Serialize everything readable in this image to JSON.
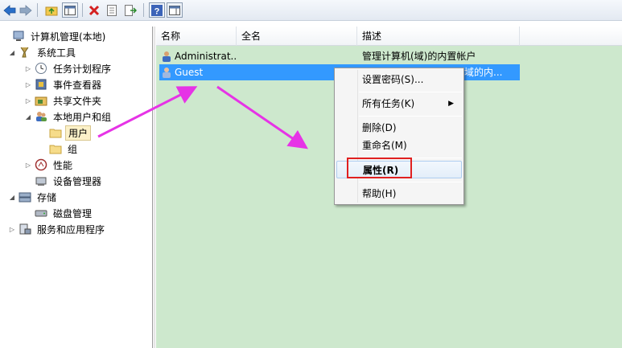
{
  "tree": {
    "items": [
      {
        "label": "计算机管理(本地)",
        "expander": "",
        "icon": "computer-management-icon"
      },
      {
        "label": "系统工具",
        "expander": "◢",
        "icon": "system-tools-icon"
      },
      {
        "label": "任务计划程序",
        "expander": "▷",
        "icon": "task-scheduler-icon"
      },
      {
        "label": "事件查看器",
        "expander": "▷",
        "icon": "event-viewer-icon"
      },
      {
        "label": "共享文件夹",
        "expander": "▷",
        "icon": "shared-folders-icon"
      },
      {
        "label": "本地用户和组",
        "expander": "◢",
        "icon": "local-users-groups-icon"
      },
      {
        "label": "用户",
        "expander": "",
        "icon": "folder-icon"
      },
      {
        "label": "组",
        "expander": "",
        "icon": "folder-icon"
      },
      {
        "label": "性能",
        "expander": "▷",
        "icon": "performance-icon"
      },
      {
        "label": "设备管理器",
        "expander": "",
        "icon": "device-manager-icon"
      },
      {
        "label": "存储",
        "expander": "◢",
        "icon": "storage-icon"
      },
      {
        "label": "磁盘管理",
        "expander": "",
        "icon": "disk-management-icon"
      },
      {
        "label": "服务和应用程序",
        "expander": "▷",
        "icon": "services-apps-icon"
      }
    ]
  },
  "list": {
    "columns": [
      "名称",
      "全名",
      "描述"
    ],
    "rows": [
      {
        "name": "Administrat...",
        "fullname": "",
        "description": "管理计算机(域)的内置帐户",
        "icon": "user-icon"
      },
      {
        "name": "Guest",
        "fullname": "",
        "description": "域的内...",
        "icon": "user-icon"
      }
    ]
  },
  "context_menu": {
    "items": [
      {
        "label": "设置密码(S)..."
      },
      {
        "label": "所有任务(K)",
        "submenu_arrow": "▶"
      },
      {
        "label": "删除(D)"
      },
      {
        "label": "重命名(M)"
      },
      {
        "label": "属性(R)"
      },
      {
        "label": "帮助(H)"
      }
    ]
  },
  "colors": {
    "list_background": "#cde8cd",
    "selection": "#3399ff",
    "highlight_box": "#e02020",
    "annotation_arrow": "#e633e6"
  }
}
